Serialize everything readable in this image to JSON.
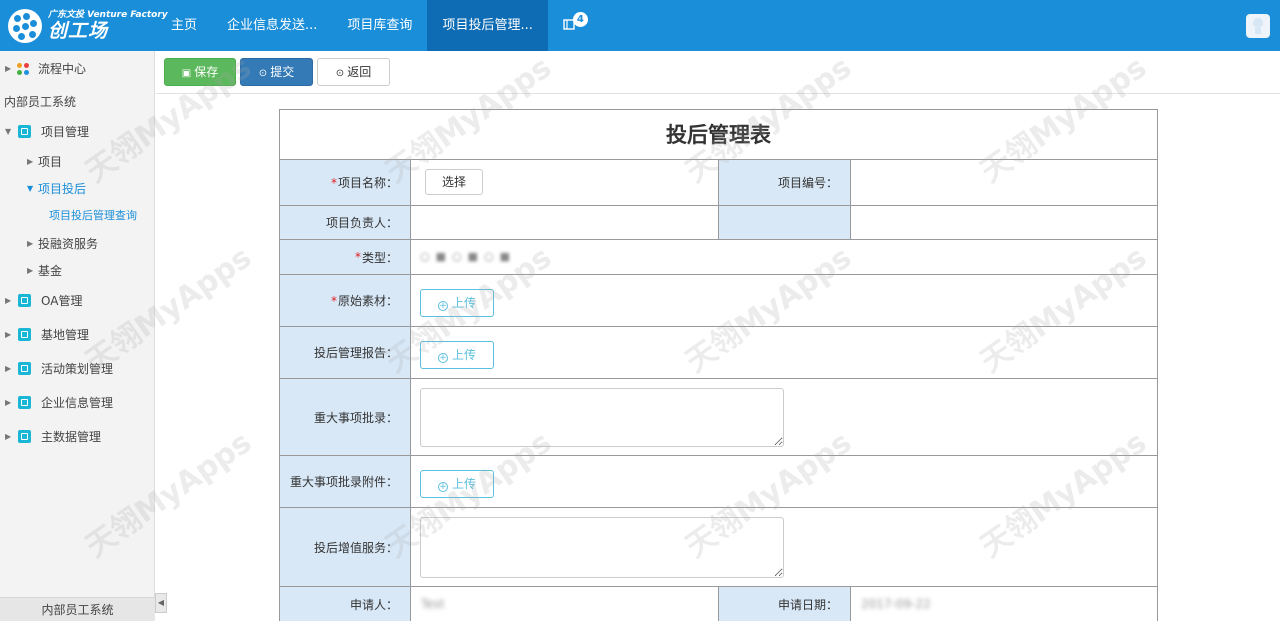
{
  "header": {
    "logo_small": "广东文投 Venture Factory",
    "logo_big": "创工场",
    "nav": [
      "主页",
      "企业信息发送...",
      "项目库查询",
      "项目投后管理...",
      ""
    ],
    "notification_count": "4",
    "active_index": 3
  },
  "sidebar": {
    "flow_center": "流程中心",
    "system_name": "内部员工系统",
    "project_mgmt": "项目管理",
    "project": "项目",
    "project_post": "项目投后",
    "post_query": "项目投后管理查询",
    "financing": "投融资服务",
    "fund": "基金",
    "oa": "OA管理",
    "base": "基地管理",
    "activity": "活动策划管理",
    "enterprise": "企业信息管理",
    "master_data": "主数据管理",
    "bottom_label": "内部员工系统"
  },
  "toolbar": {
    "save": "保存",
    "submit": "提交",
    "back": "返回"
  },
  "form": {
    "title": "投后管理表",
    "project_name_label": "项目名称：",
    "choose_btn": "选择",
    "project_no_label": "项目编号：",
    "owner_label": "项目负责人：",
    "type_label": "类型：",
    "material_label": "原始素材：",
    "upload": "上传",
    "report_label": "投后管理报告：",
    "major_label": "重大事项批录：",
    "major_attach_label": "重大事项批录附件：",
    "value_service_label": "投后增值服务：",
    "applicant_label": "申请人：",
    "applicant_value": "Test",
    "apply_date_label": "申请日期：",
    "apply_date_value": "2017-09-22",
    "required_mark": "*"
  },
  "watermark": "天翎MyApps",
  "colors": {
    "header_bg": "#1a8ed8",
    "label_bg": "#d9e8f7",
    "save_btn": "#5cb85c",
    "submit_btn": "#337ab7",
    "upload_border": "#5bc0de",
    "sidebar_icon": "#1ab6d6"
  }
}
